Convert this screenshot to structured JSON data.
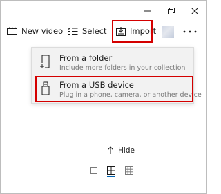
{
  "toolbar": {
    "new_video_label": "New video",
    "select_label": "Select",
    "import_label": "Import"
  },
  "import_menu": {
    "items": [
      {
        "title": "From a folder",
        "subtitle": "Include more folders in your collection",
        "icon": "folder-add-icon"
      },
      {
        "title": "From a USB device",
        "subtitle": "Plug in a phone, camera, or another device",
        "icon": "usb-icon"
      }
    ]
  },
  "hide": {
    "label": "Hide"
  },
  "view_modes": {
    "selected": "medium-grid",
    "options": [
      "single-view",
      "medium-grid",
      "small-grid"
    ]
  },
  "colors": {
    "highlight_border": "#d40000",
    "accent": "#0063b1",
    "menu_background": "#f2f2f2",
    "subtitle_text": "#7a7a7a"
  }
}
